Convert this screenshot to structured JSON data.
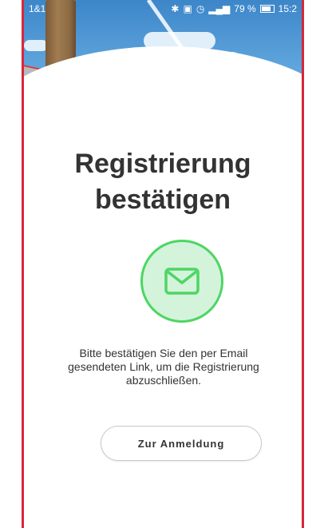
{
  "status_bar": {
    "carrier": "1&1",
    "signal_info": "❀",
    "battery_percent": "79 %",
    "time": "15:2"
  },
  "page": {
    "title_line1": "Registrierung",
    "title_line2": "bestätigen",
    "message_line1": "Bitte bestätigen Sie den per Email",
    "message_line2": "gesendeten Link, um die Registrierung",
    "message_line3": "abzuschließen.",
    "button_label": "Zur Anmeldung"
  },
  "icons": {
    "mail": "envelope-icon"
  },
  "colors": {
    "accent_green": "#4cd663",
    "frame_red": "#d6283a",
    "text": "#333333"
  }
}
